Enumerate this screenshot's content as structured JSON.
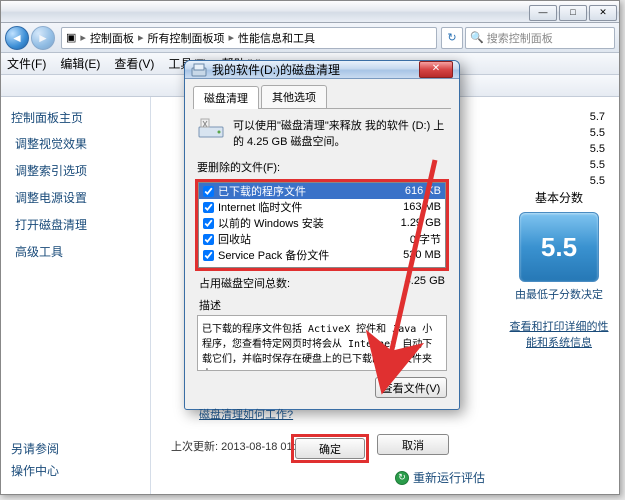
{
  "main_window": {
    "breadcrumb": [
      "控制面板",
      "所有控制面板项",
      "性能信息和工具"
    ],
    "search_placeholder": "搜索控制面板",
    "menu": {
      "file": "文件(F)",
      "edit": "编辑(E)",
      "view": "查看(V)",
      "tools": "工具(T)",
      "help": "帮助(H)"
    },
    "sidebar": {
      "title": "控制面板主页",
      "items": [
        "调整视觉效果",
        "调整索引选项",
        "调整电源设置",
        "打开磁盘清理",
        "高级工具"
      ],
      "see_also_label": "另请参阅",
      "action_center": "操作中心"
    },
    "scores": [
      "5.7",
      "5.5",
      "5.5",
      "5.5",
      "5.5"
    ],
    "base_score_label": "基本分数",
    "base_score_value": "5.5",
    "base_score_caption": "由最低子分数决定",
    "detail_link": "查看和打印详细的性能和系统信息",
    "last_update": "上次更新: 2013-08-18 01:02:30",
    "rerun_label": "重新运行评估"
  },
  "dialog": {
    "title": "我的软件(D:)的磁盘清理",
    "tabs": {
      "cleanup": "磁盘清理",
      "more": "其他选项"
    },
    "info_text": "可以使用\"磁盘清理\"来释放 我的软件 (D:) 上的 4.25 GB 磁盘空间。",
    "list_label": "要删除的文件(F):",
    "files": [
      {
        "name": "已下载的程序文件",
        "size": "616 KB",
        "checked": true,
        "selected": true
      },
      {
        "name": "Internet 临时文件",
        "size": "163 MB",
        "checked": true,
        "selected": false
      },
      {
        "name": "以前的 Windows 安装",
        "size": "1.29 GB",
        "checked": true,
        "selected": false
      },
      {
        "name": "回收站",
        "size": "0 字节",
        "checked": true,
        "selected": false
      },
      {
        "name": "Service Pack 备份文件",
        "size": "530 MB",
        "checked": true,
        "selected": false
      }
    ],
    "total_label": "占用磁盘空间总数:",
    "total_value": "4.25 GB",
    "desc_label": "描述",
    "desc_text": "已下载的程序文件包括 ActiveX 控件和 Java 小程序，您查看特定网页时将会从 Internet 自动下载它们，并临时保存在硬盘上的已下载的程序文件夹中。",
    "view_files_btn": "查看文件(V)",
    "howto_link": "磁盘清理如何工作?",
    "ok_btn": "确定",
    "cancel_btn": "取消"
  }
}
